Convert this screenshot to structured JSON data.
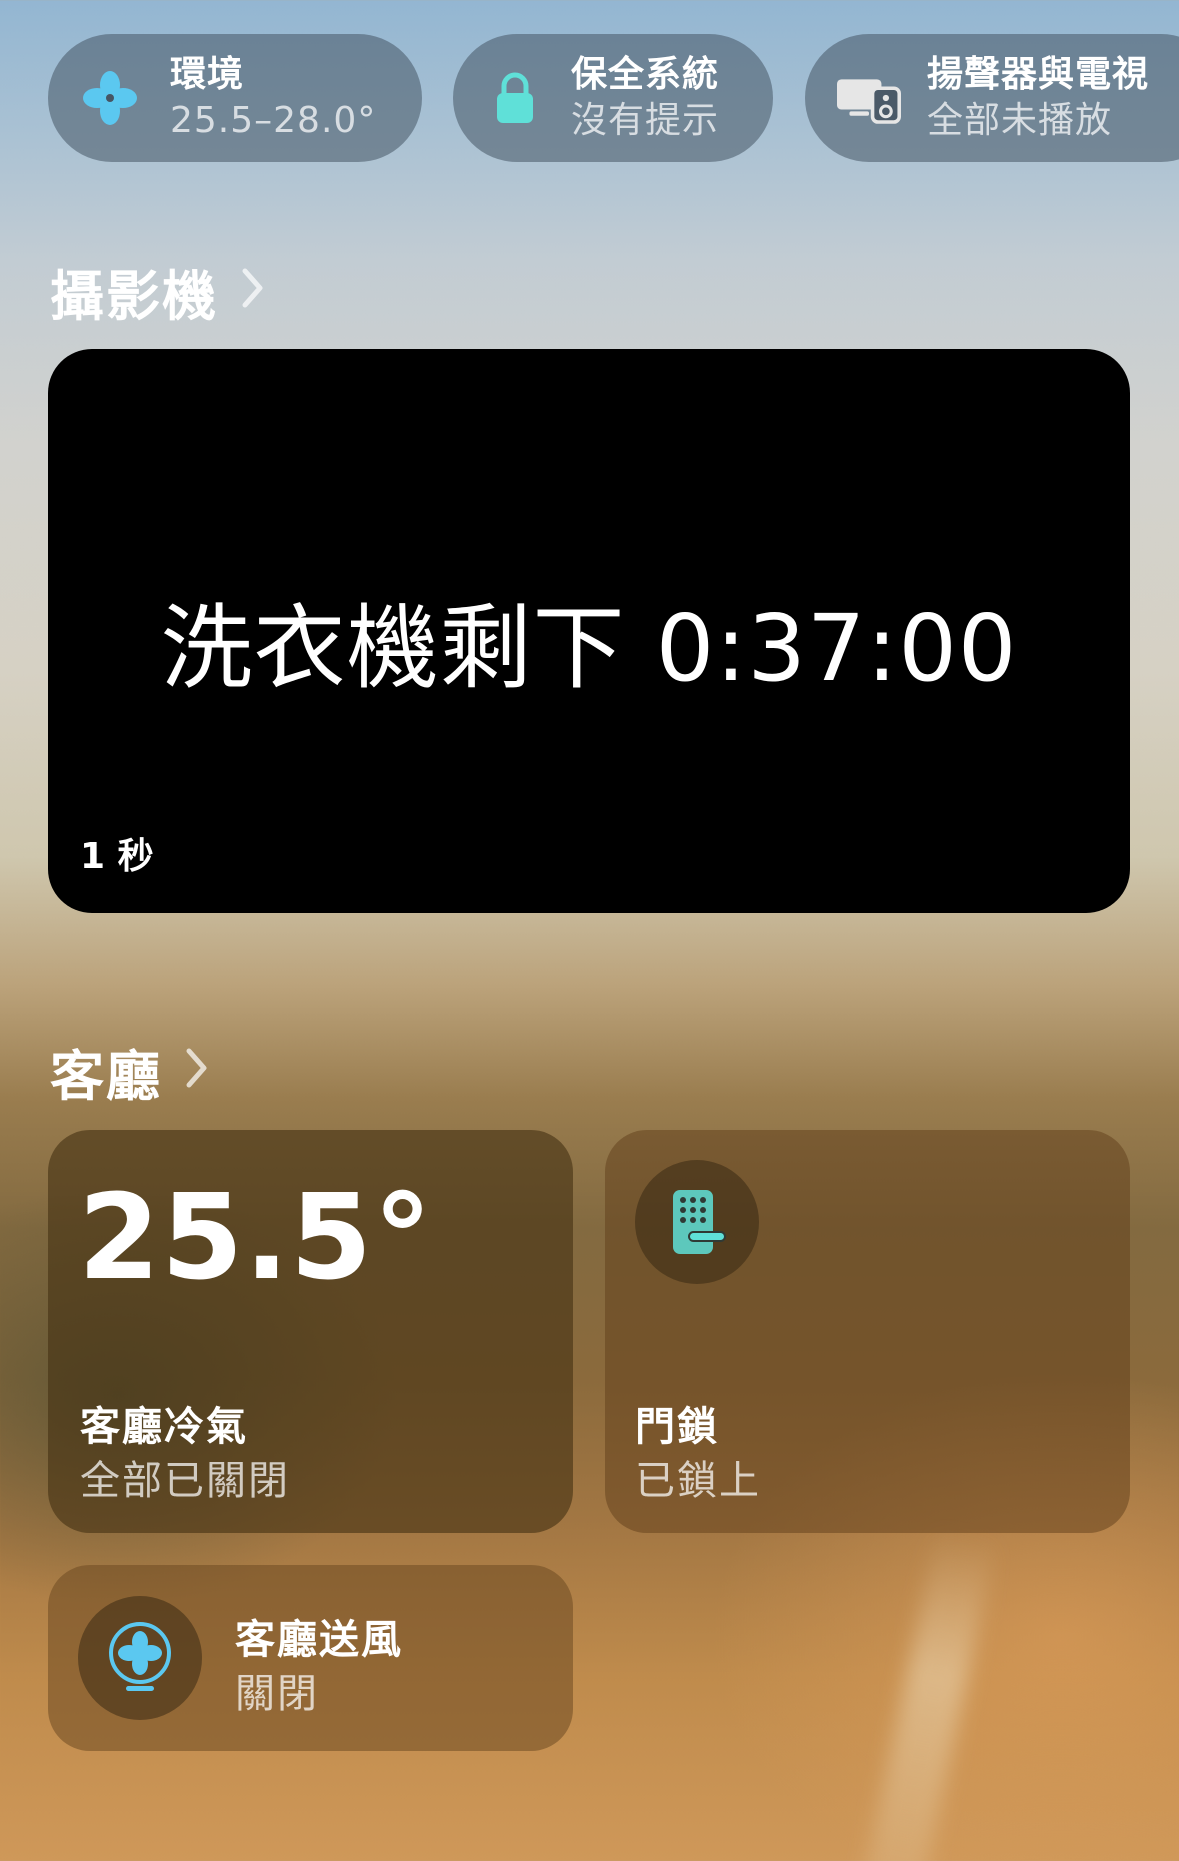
{
  "status_pills": {
    "climate": {
      "title": "環境",
      "subtitle": "25.5–28.0°",
      "icon": "fan-icon",
      "icon_color": "#5bc8f0"
    },
    "security": {
      "title": "保全系統",
      "subtitle": "沒有提示",
      "icon": "lock-icon",
      "icon_color": "#5fe0d8"
    },
    "speakers": {
      "title": "揚聲器與電視",
      "subtitle": "全部未播放",
      "icon": "speaker-tv-icon"
    }
  },
  "cameras_section": {
    "title": "攝影機",
    "camera": {
      "overlay_text": "洗衣機剩下 0:37:00",
      "age_label": "1 秒"
    }
  },
  "living_room_section": {
    "title": "客廳",
    "ac_tile": {
      "temperature": "25.5°",
      "name": "客廳冷氣",
      "status": "全部已關閉"
    },
    "lock_tile": {
      "name": "門鎖",
      "status": "已鎖上",
      "icon": "keypad-lock-icon",
      "icon_color": "#5fe0d8"
    },
    "fan_tile": {
      "name": "客廳送風",
      "status": "關閉",
      "icon": "desk-fan-icon",
      "icon_color": "#5bc8f0"
    }
  }
}
